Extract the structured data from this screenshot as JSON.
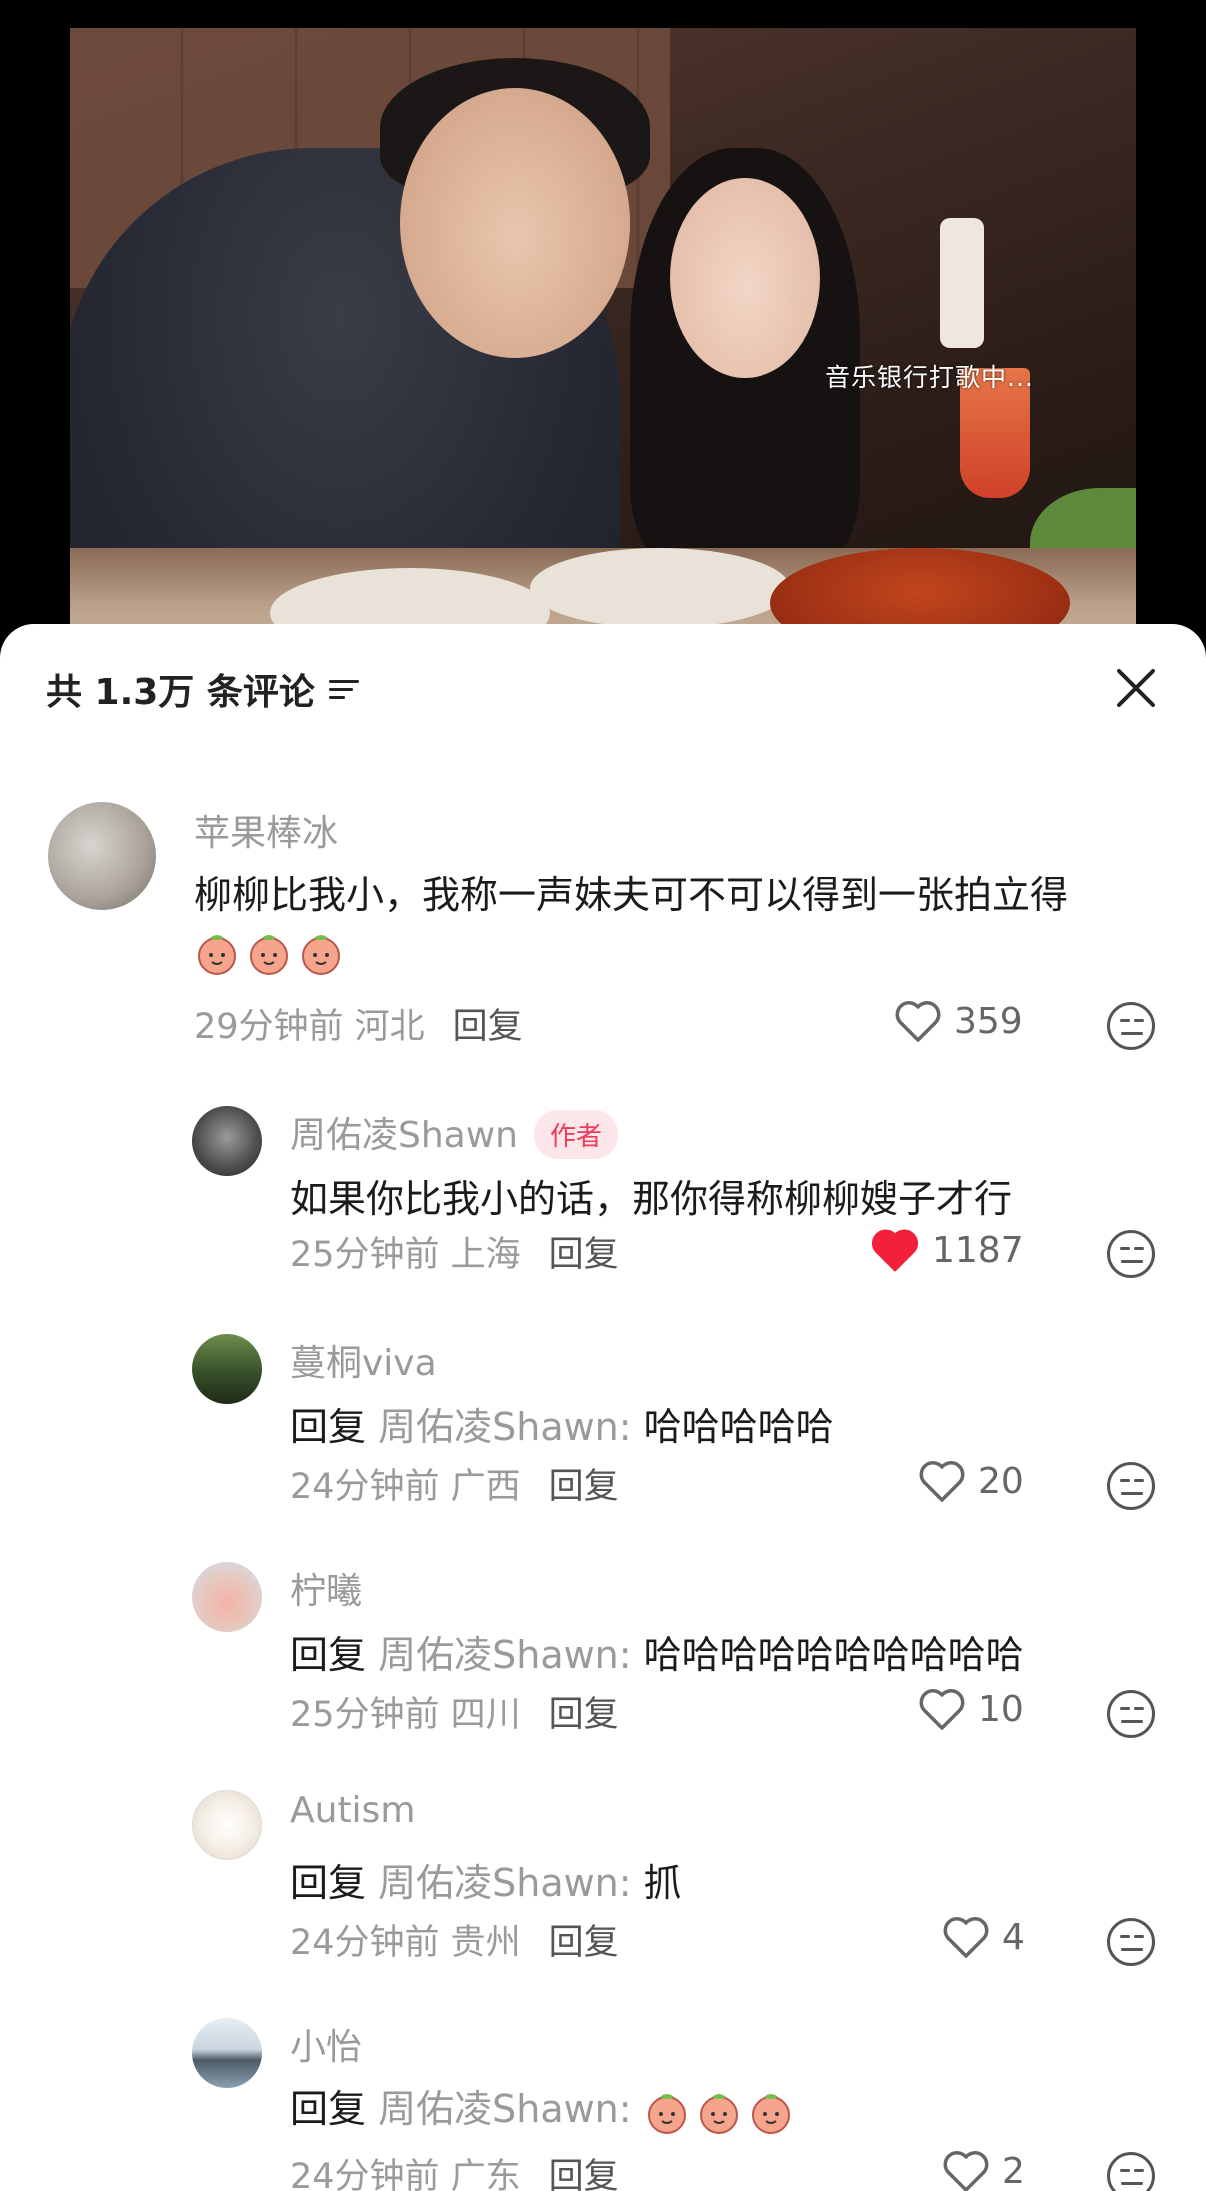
{
  "video": {
    "caption": "音乐银行打歌中..."
  },
  "header": {
    "comment_count": "共 1.3万 条评论"
  },
  "comments": [
    {
      "username": "苹果棒冰",
      "text": "柳柳比我小，我称一声妹夫可不可以得到一张拍立得",
      "emojis": [
        "peach-emoji",
        "peach-emoji",
        "peach-emoji"
      ],
      "time_location": "29分钟前 河北",
      "reply_label": "回复",
      "likes": "359",
      "liked": false
    },
    {
      "username": "周佑凌Shawn",
      "badge": "作者",
      "text": "如果你比我小的话，那你得称柳柳嫂子才行",
      "time_location": "25分钟前 上海",
      "reply_label": "回复",
      "likes": "1187",
      "liked": true
    },
    {
      "username": "蔓桐viva",
      "reply_prefix": "回复",
      "reply_to": "周佑凌Shawn:",
      "text": " 哈哈哈哈哈",
      "time_location": "24分钟前 广西",
      "reply_label": "回复",
      "likes": "20",
      "liked": false
    },
    {
      "username": "柠曦",
      "reply_prefix": "回复",
      "reply_to": "周佑凌Shawn:",
      "text": " 哈哈哈哈哈哈哈哈哈哈",
      "time_location": "25分钟前 四川",
      "reply_label": "回复",
      "likes": "10",
      "liked": false
    },
    {
      "username": "Autism",
      "reply_prefix": "回复",
      "reply_to": "周佑凌Shawn:",
      "text": " 抓",
      "time_location": "24分钟前 贵州",
      "reply_label": "回复",
      "likes": "4",
      "liked": false
    },
    {
      "username": "小怡",
      "reply_prefix": "回复",
      "reply_to": "周佑凌Shawn:",
      "emojis": [
        "peach-emoji",
        "peach-emoji",
        "peach-emoji"
      ],
      "time_location": "24分钟前 广东",
      "reply_label": "回复",
      "likes": "2",
      "liked": false
    }
  ],
  "colors": {
    "like_active": "#f2203a",
    "muted_text": "#9a9a9a",
    "author_badge": "#ea3c5a"
  }
}
